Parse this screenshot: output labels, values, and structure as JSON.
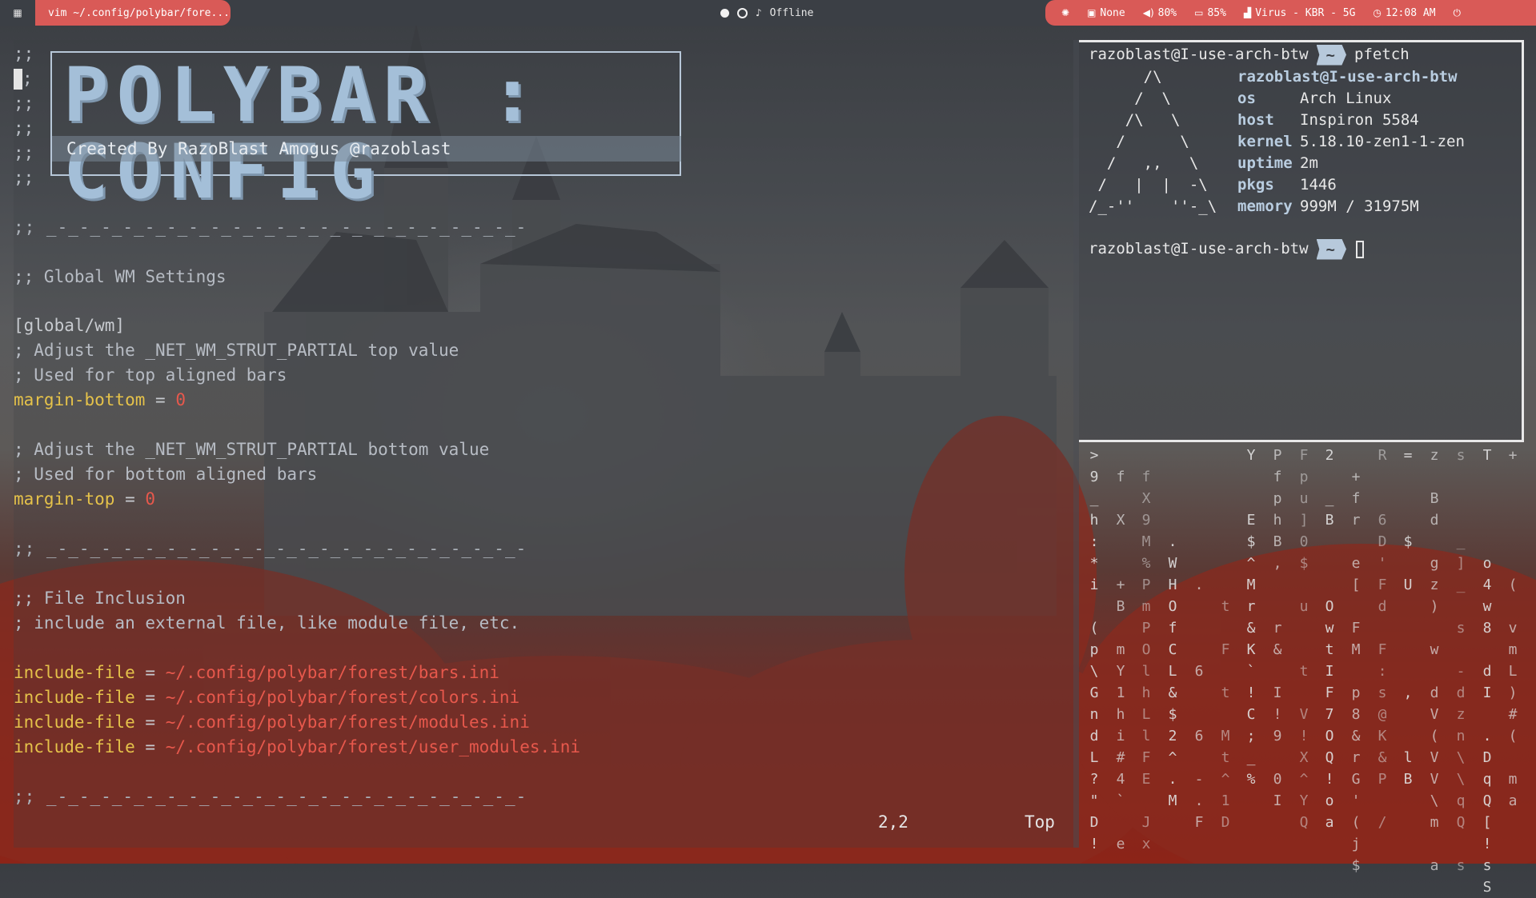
{
  "colors": {
    "bar_bg": "#3b3f45",
    "accent": "#d95a57",
    "vim_key": "#e5c24a",
    "vim_string": "#e7584c",
    "vim_comment": "#b7bcc4",
    "term_highlight": "#b9cde0"
  },
  "polybar": {
    "menu_icon": "grid-menu-icon",
    "window_title": "vim ~/.config/polybar/fore...",
    "center": {
      "music_status": "Offline"
    },
    "modules": {
      "updates": "None",
      "volume": "80%",
      "battery": "85%",
      "network": "Virus - KBR - 5G",
      "time": "12:08 AM"
    }
  },
  "vim": {
    "banner": {
      "title": "POLYBAR : CONFIG",
      "subtitle": "Created By RazoBlast Amogus @razoblast"
    },
    "lines": [
      ";;",
      ";",
      ";;",
      ";;",
      ";;",
      ";;",
      ";; _-_-_-_-_-_-_-_-_-_-_-_-_-_-_-_-_-_-_-_-_-_-",
      ";; Global WM Settings",
      "[global/wm]",
      "; Adjust the _NET_WM_STRUT_PARTIAL top value",
      "; Used for top aligned bars",
      "margin-bottom",
      "0",
      "; Adjust the _NET_WM_STRUT_PARTIAL bottom value",
      "; Used for bottom aligned bars",
      "margin-top",
      "0",
      ";; _-_-_-_-_-_-_-_-_-_-_-_-_-_-_-_-_-_-_-_-_-_-",
      ";; File Inclusion",
      "; include an external file, like module file, etc.",
      "include-file",
      "~/.config/polybar/forest/bars.ini",
      "~/.config/polybar/forest/colors.ini",
      "~/.config/polybar/forest/modules.ini",
      "~/.config/polybar/forest/user_modules.ini",
      ";; _-_-_-_-_-_-_-_-_-_-_-_-_-_-_-_-_-_-_-_-_-_-"
    ],
    "equals": "=",
    "status": {
      "position": "2,2",
      "scroll": "Top"
    }
  },
  "terminal": {
    "user_host": "razoblast@I-use-arch-btw",
    "tilde": "~",
    "command": "pfetch",
    "logo": "      /\\\n     /  \\\n    /\\   \\\n   /      \\\n  /   ,,   \\\n /   |  |  -\\\n/_-''    ''-_\\",
    "info_header": "razoblast@I-use-arch-btw",
    "info": [
      {
        "key": "os",
        "value": "Arch Linux"
      },
      {
        "key": "host",
        "value": "Inspiron 5584"
      },
      {
        "key": "kernel",
        "value": "5.18.10-zen1-1-zen"
      },
      {
        "key": "uptime",
        "value": "2m"
      },
      {
        "key": "pkgs",
        "value": "1446"
      },
      {
        "key": "memory",
        "value": "999M / 31975M"
      }
    ]
  },
  "matrix": {
    "columns": [
      ">9_h:*i (p\\GndL?\"D!",
      " f X  +B mY1hi#4` e",
      " fX9M%PmPOlhLlFE Jx",
      "    .WHOfCL&$2^.M",
      "      .   6  6 -.F",
      "       t F t Mt^1D",
      "Y  E$^Mr&K`!C;_%",
      "PfphB,  r& I!9 0I",
      "Fpu]0$ u  t V!X^YQ",
      "2 _B   OwtIF7OQ!oa",
      " +fr e[ FM p8&rG'(j$",
      "R  6D'Fd F:s@K&P /",
      "=   $ U    ,  lB",
      "z Bd gz) w dV(VV\\m a",
      "s   _]_ s -dzn\\\\qQ s",
      "T    o4w8 dI .DqQ[!sS",
      "+     ( vmL)#( ma"
    ]
  }
}
